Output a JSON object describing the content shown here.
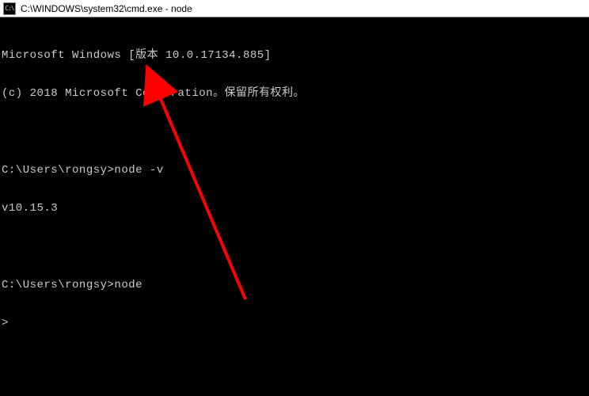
{
  "titlebar": {
    "icon_text": "C:\\",
    "title": "C:\\WINDOWS\\system32\\cmd.exe - node"
  },
  "terminal": {
    "lines": [
      "Microsoft Windows [版本 10.0.17134.885]",
      "(c) 2018 Microsoft Corporation。保留所有权利。",
      "",
      "C:\\Users\\rongsy>node -v",
      "v10.15.3",
      "",
      "C:\\Users\\rongsy>node",
      ">"
    ]
  },
  "annotation": {
    "arrow_color": "#ff0000"
  }
}
